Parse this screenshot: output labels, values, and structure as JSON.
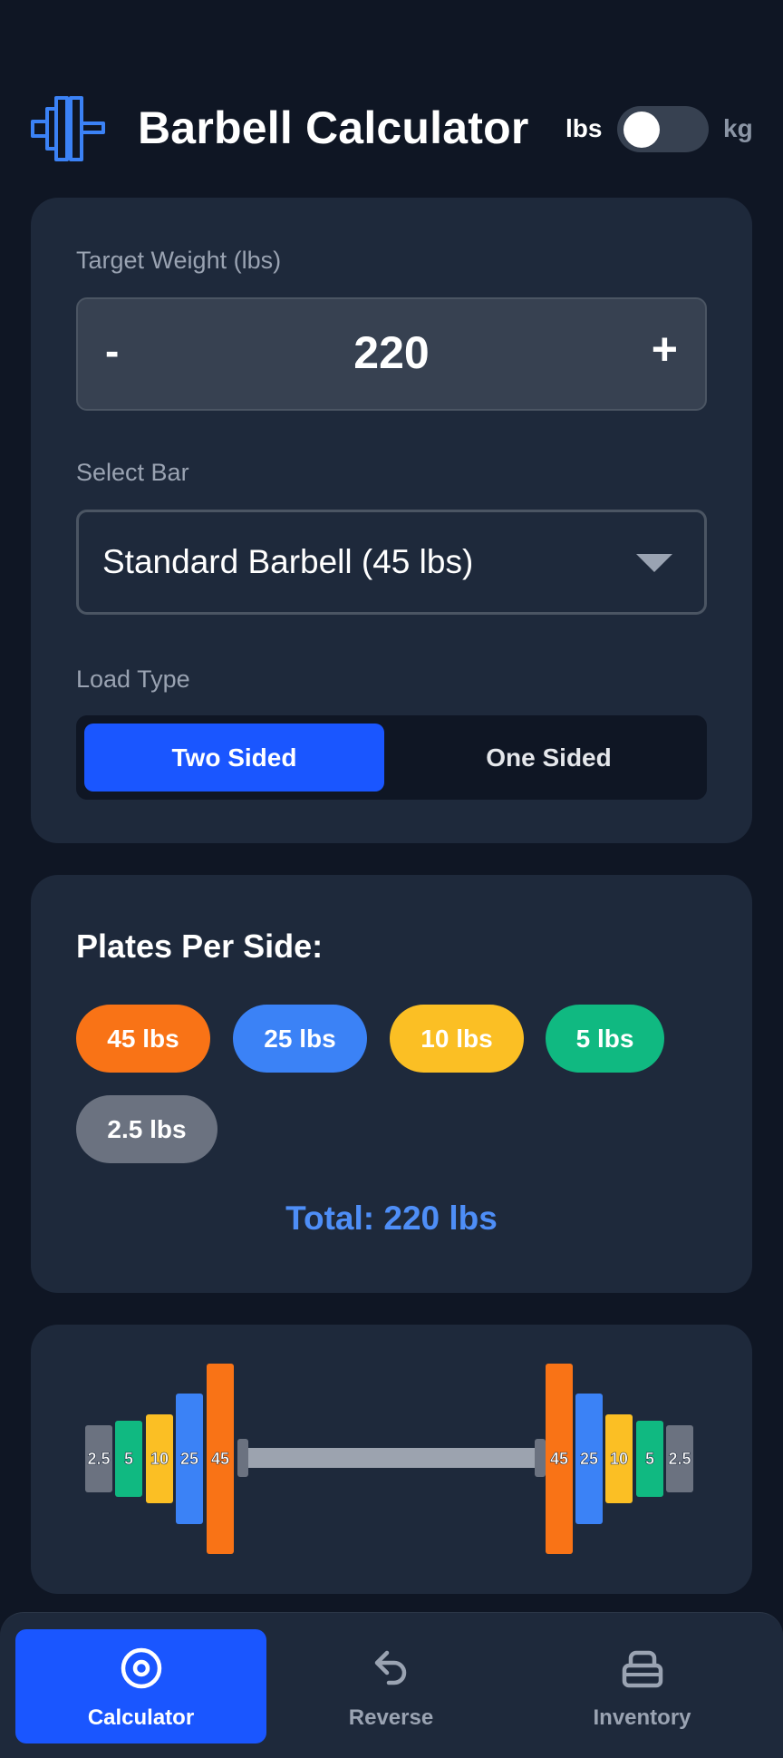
{
  "header": {
    "title": "Barbell Calculator",
    "unit_left": "lbs",
    "unit_right": "kg",
    "unit_toggle_selected": "lbs"
  },
  "input": {
    "target_label": "Target Weight (lbs)",
    "target_value": "220",
    "minus": "-",
    "plus": "+",
    "bar_label": "Select Bar",
    "bar_selected": "Standard Barbell (45 lbs)",
    "load_label": "Load Type",
    "load_options": [
      "Two Sided",
      "One Sided"
    ],
    "load_selected": "Two Sided"
  },
  "plates": {
    "title": "Plates Per Side:",
    "chips": [
      {
        "label": "45 lbs",
        "color": "#f97316"
      },
      {
        "label": "25 lbs",
        "color": "#3b82f6"
      },
      {
        "label": "10 lbs",
        "color": "#fbbf24"
      },
      {
        "label": "5 lbs",
        "color": "#10b981"
      },
      {
        "label": "2.5 lbs",
        "color": "#6b7280"
      }
    ],
    "total": "Total: 220 lbs"
  },
  "visual": {
    "left_labels": [
      "2.5",
      "5",
      "10",
      "25",
      "45"
    ],
    "right_labels": [
      "45",
      "25",
      "10",
      "5",
      "2.5"
    ],
    "bar_color": "#9ca3af"
  },
  "nav": {
    "items": [
      {
        "label": "Calculator",
        "icon": "target-icon",
        "active": true
      },
      {
        "label": "Reverse",
        "icon": "undo-arrow-icon",
        "active": false
      },
      {
        "label": "Inventory",
        "icon": "stack-icon",
        "active": false
      }
    ]
  }
}
